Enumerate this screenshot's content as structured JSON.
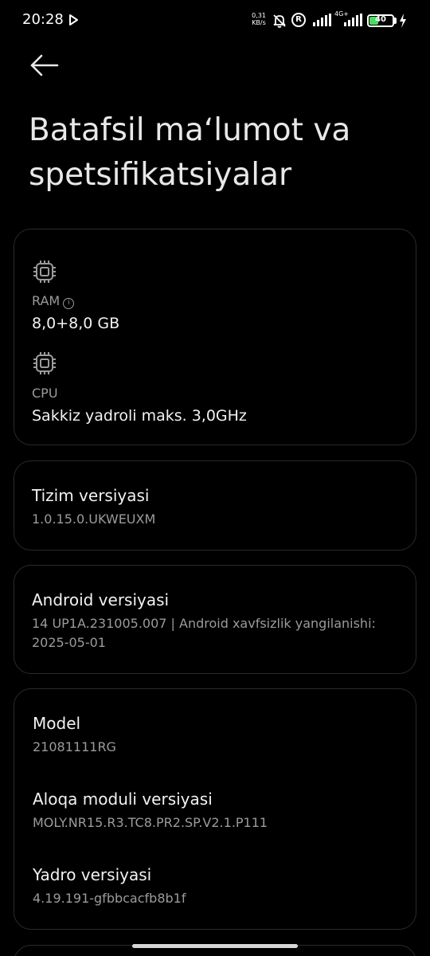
{
  "status_bar": {
    "time": "20:28",
    "net_speed_value": "0,31",
    "net_speed_unit": "KB/s",
    "roaming_label": "R",
    "network_type": "4G+",
    "battery_level": "40",
    "battery_percent": 40
  },
  "header": {
    "title": "Batafsil maʻlumot va spetsifikatsiyalar"
  },
  "hardware": {
    "ram_label": "RAM",
    "ram_value": "8,0+8,0 GB",
    "cpu_label": "CPU",
    "cpu_value": "Sakkiz yadroli maks. 3,0GHz"
  },
  "system_version": {
    "title": "Tizim versiyasi",
    "value": "1.0.15.0.UKWEUXM"
  },
  "android_version": {
    "title": "Android versiyasi",
    "value_line1": "14 UP1A.231005.007 | Android xavfsizlik yangilanishi:",
    "value_line2": "2025-05-01"
  },
  "device_info": {
    "model_title": "Model",
    "model_value": "21081111RG",
    "baseband_title": "Aloqa moduli versiyasi",
    "baseband_value": "MOLY.NR15.R3.TC8.PR2.SP.V2.1.P111",
    "kernel_title": "Yadro versiyasi",
    "kernel_value": "4.19.191-gfbbcacfb8b1f"
  },
  "icons": {
    "back": "back-arrow-icon",
    "ram": "chip-icon",
    "cpu": "chip-icon",
    "info": "info-icon",
    "bell": "bell-off-icon",
    "play": "play-icon",
    "charging": "bolt-icon"
  },
  "colors": {
    "background": "#000000",
    "card_border": "#2a2a2a",
    "primary_text": "#f2f2f2",
    "secondary_text": "#9b9b9b",
    "battery_fill": "#4cd964"
  }
}
